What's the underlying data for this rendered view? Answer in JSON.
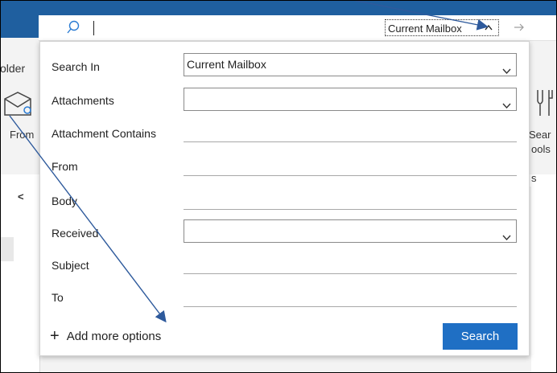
{
  "searchbar": {
    "scope_value": "Current Mailbox"
  },
  "background": {
    "ribbon_partial_folder": "older",
    "ribbon_partial_from": "From",
    "ribbon_partial_search": "Sear",
    "ribbon_partial_tools": "ools",
    "ribbon_partial_s": "s",
    "collapse_chevron": "<"
  },
  "panel": {
    "fields": [
      {
        "label": "Search In",
        "type": "select",
        "value": "Current Mailbox"
      },
      {
        "label": "Attachments",
        "type": "select",
        "value": ""
      },
      {
        "label": "Attachment Contains",
        "type": "text",
        "value": ""
      },
      {
        "label": "From",
        "type": "text",
        "value": ""
      },
      {
        "label": "Body",
        "type": "text",
        "value": ""
      },
      {
        "label": "Received",
        "type": "select",
        "value": ""
      },
      {
        "label": "Subject",
        "type": "text",
        "value": ""
      },
      {
        "label": "To",
        "type": "text",
        "value": ""
      }
    ],
    "add_more_options": "Add more options",
    "search_button": "Search"
  },
  "colors": {
    "titlebar": "#1f5f9f",
    "search_button": "#1f6fc4",
    "annotation_arrow": "#2e5a9c"
  },
  "icons": [
    "search-icon",
    "chevron-up-icon",
    "chevron-down-icon",
    "arrow-right-icon",
    "plus-icon",
    "chevron-left-icon"
  ]
}
